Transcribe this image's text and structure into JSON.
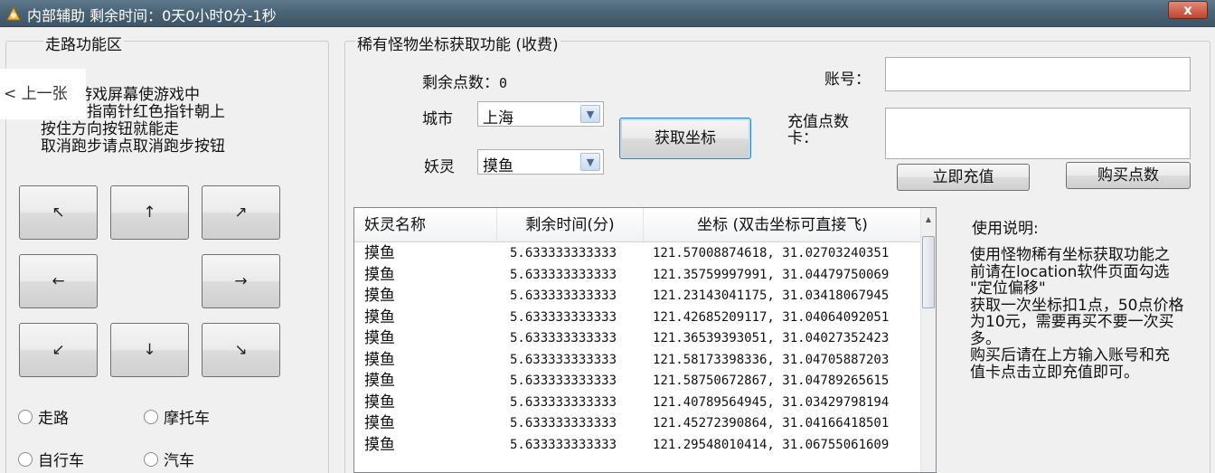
{
  "window": {
    "title": "内部辅助 剩余时间：0天0小时0分-1秒",
    "close_label": "x"
  },
  "nav": {
    "prev_label": "< 上一张"
  },
  "walk_group": {
    "title": "走路功能区",
    "instructions": [
      "游戏屏幕使游戏中",
      "右上角指南针红色指针朝上",
      "按住方向按钮就能走",
      "取消跑步请点取消跑步按钮"
    ],
    "directions": {
      "up_left": "↖",
      "up": "↑",
      "up_right": "↗",
      "left": "←",
      "right": "→",
      "down_left": "↙",
      "down": "↓",
      "down_right": "↘"
    },
    "modes": [
      "走路",
      "摩托车",
      "自行车",
      "汽车"
    ]
  },
  "coord_group": {
    "title": "稀有怪物坐标获取功能 (收费)",
    "points_label": "剩余点数：",
    "points_value": "0",
    "city_label": "城市",
    "city_value": "上海",
    "spirit_label": "妖灵",
    "spirit_value": "摸鱼",
    "get_button": "获取坐标",
    "account_label": "账号：",
    "account_value": "",
    "card_label_1": "充值点数",
    "card_label_2": "卡：",
    "card_value": "",
    "recharge_button": "立即充值",
    "buy_button": "购买点数"
  },
  "table": {
    "columns": [
      "妖灵名称",
      "剩余时间(分)",
      "坐标 (双击坐标可直接飞)"
    ],
    "rows": [
      [
        "摸鱼",
        "5.633333333333",
        "121.57008874618, 31.02703240351"
      ],
      [
        "摸鱼",
        "5.633333333333",
        "121.35759997991, 31.04479750069"
      ],
      [
        "摸鱼",
        "5.633333333333",
        "121.23143041175, 31.03418067945"
      ],
      [
        "摸鱼",
        "5.633333333333",
        "121.42685209117, 31.04064092051"
      ],
      [
        "摸鱼",
        "5.633333333333",
        "121.36539393051, 31.04027352423"
      ],
      [
        "摸鱼",
        "5.633333333333",
        "121.58173398336, 31.04705887203"
      ],
      [
        "摸鱼",
        "5.633333333333",
        "121.58750672867, 31.04789265615"
      ],
      [
        "摸鱼",
        "5.633333333333",
        "121.40789564945, 31.03429798194"
      ],
      [
        "摸鱼",
        "5.633333333333",
        "121.45272390864, 31.04166418501"
      ],
      [
        "摸鱼",
        "5.633333333333",
        "121.29548010414, 31.06755061609"
      ]
    ]
  },
  "help": {
    "title": "使用说明:",
    "lines": [
      "使用怪物稀有坐标获取功能之",
      "前请在location软件页面勾选",
      "\"定位偏移\"",
      "获取一次坐标扣1点，50点价格",
      "为10元，需要再买不要一次买",
      "多。",
      "购买后请在上方输入账号和充",
      "值卡点击立即充值即可。"
    ]
  }
}
